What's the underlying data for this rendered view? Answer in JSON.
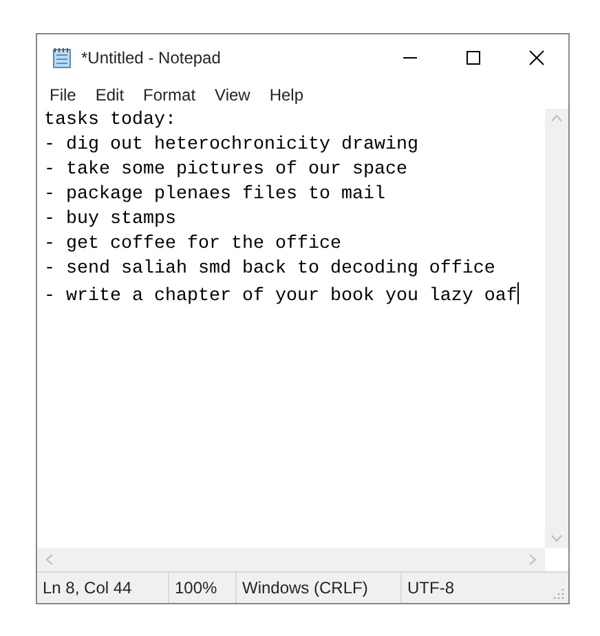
{
  "window": {
    "title": "*Untitled - Notepad"
  },
  "menu": [
    "File",
    "Edit",
    "Format",
    "View",
    "Help"
  ],
  "editor": {
    "lines": [
      "tasks today:",
      "- dig out heterochronicity drawing",
      "- take some pictures of our space",
      "- package plenaes files to mail",
      "- buy stamps",
      "- get coffee for the office",
      "- send saliah smd back to decoding office",
      "- write a chapter of your book you lazy oaf"
    ]
  },
  "status_bar": [
    "Ln 8, Col 44",
    "100%",
    "Windows (CRLF)",
    "UTF-8"
  ]
}
